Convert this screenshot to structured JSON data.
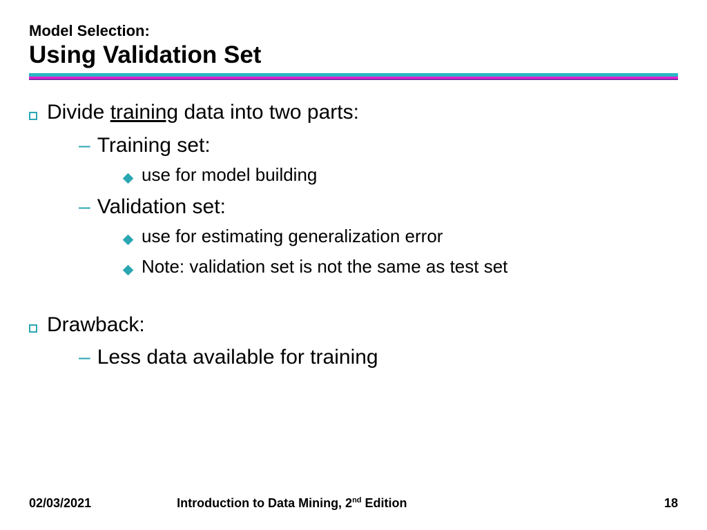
{
  "header": {
    "kicker": "Model Selection:",
    "title": "Using Validation Set"
  },
  "bullets": {
    "b1_pre": "Divide ",
    "b1_underlined": "training",
    "b1_post": " data into two parts:",
    "b1a": "Training set:",
    "b1a_i": "use for model building",
    "b1b": "Validation set:",
    "b1b_i": "use for estimating generalization error",
    "b1b_ii": "Note: validation set is not the same as test set",
    "b2": "Drawback:",
    "b2a": "Less data available for training"
  },
  "footer": {
    "date": "02/03/2021",
    "book_pre": "Introduction to Data Mining, 2",
    "book_sup": "nd",
    "book_post": " Edition",
    "page": "18"
  }
}
